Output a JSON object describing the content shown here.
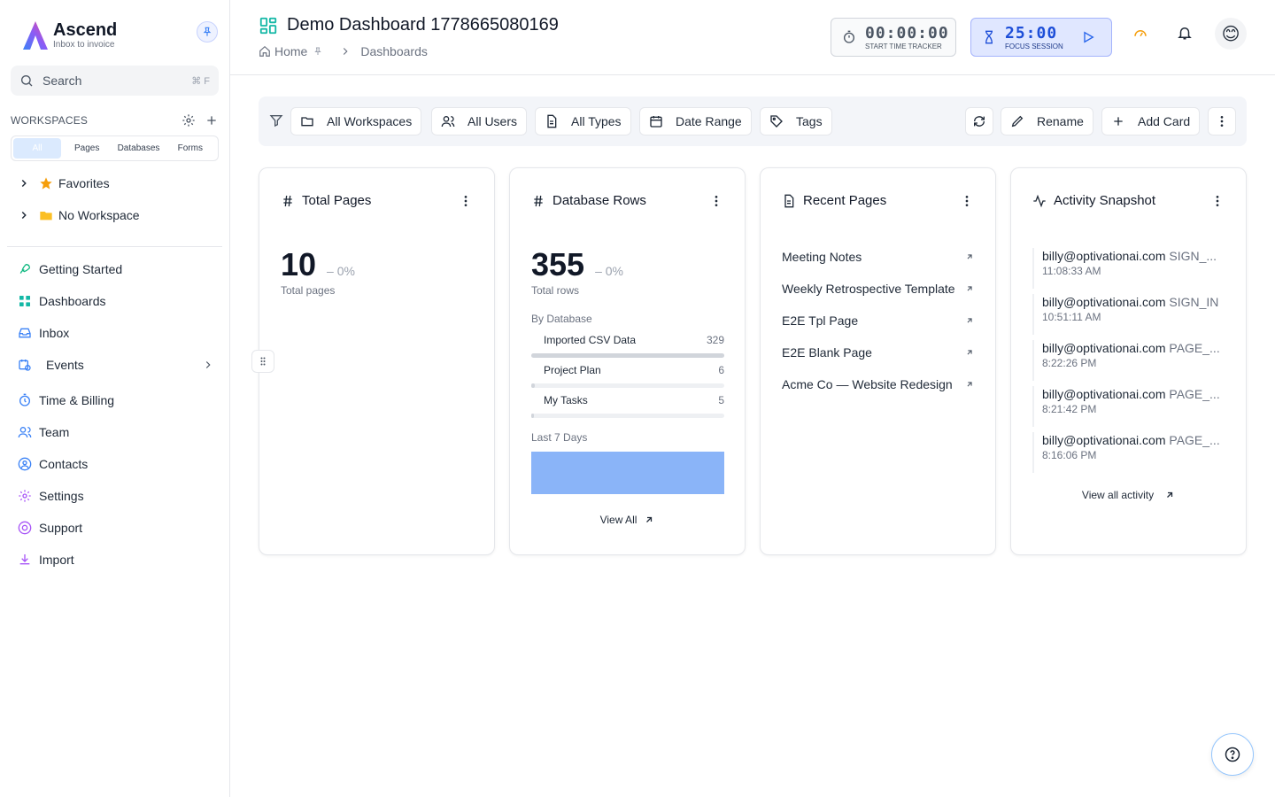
{
  "brand": {
    "name": "Ascend",
    "tagline": "Inbox to invoice"
  },
  "search": {
    "label": "Search",
    "shortcut": "⌘ F"
  },
  "workspaces": {
    "title": "WORKSPACES",
    "tabs": [
      "All",
      "Pages",
      "Databases",
      "Forms"
    ],
    "active_tab": "All",
    "tree": [
      {
        "label": "Favorites",
        "icon": "star-icon"
      },
      {
        "label": "No Workspace",
        "icon": "folder-icon"
      }
    ]
  },
  "nav": [
    {
      "label": "Getting Started",
      "icon": "rocket-icon"
    },
    {
      "label": "Dashboards",
      "icon": "dashboard-icon"
    },
    {
      "label": "Inbox",
      "icon": "inbox-icon"
    },
    {
      "label": "Events",
      "icon": "calendar-clock-icon"
    },
    {
      "label": "Time & Billing",
      "icon": "timer-icon"
    },
    {
      "label": "Team",
      "icon": "users-icon"
    },
    {
      "label": "Contacts",
      "icon": "contact-icon"
    },
    {
      "label": "Settings",
      "icon": "gear-icon"
    },
    {
      "label": "Support",
      "icon": "lifebuoy-icon"
    },
    {
      "label": "Import",
      "icon": "download-icon"
    }
  ],
  "header": {
    "title": "Demo Dashboard 1778665080169",
    "breadcrumb": {
      "home": "Home",
      "current": "Dashboards"
    },
    "tracker": {
      "time": "00:00:00",
      "caption": "START TIME TRACKER"
    },
    "focus": {
      "time": "25:00",
      "caption": "FOCUS SESSION"
    },
    "avatar": "😊"
  },
  "toolbar": {
    "workspaces": "All Workspaces",
    "users": "All Users",
    "types": "All Types",
    "date_range": "Date Range",
    "tags": "Tags",
    "rename": "Rename",
    "add_card": "Add Card"
  },
  "cards": {
    "total_pages": {
      "title": "Total Pages",
      "value": "10",
      "delta": "– 0%",
      "label": "Total pages"
    },
    "database_rows": {
      "title": "Database Rows",
      "value": "355",
      "delta": "– 0%",
      "label": "Total rows",
      "by_database_label": "By Database",
      "rows": [
        {
          "name": "Imported CSV Data",
          "value": 329
        },
        {
          "name": "Project Plan",
          "value": 6
        },
        {
          "name": "My Tasks",
          "value": 5
        }
      ],
      "last7_label": "Last 7 Days",
      "view_all": "View All"
    },
    "recent_pages": {
      "title": "Recent Pages",
      "items": [
        "Meeting Notes",
        "Weekly Retrospective Template",
        "E2E Tpl Page",
        "E2E Blank Page",
        "Acme Co — Website Redesign"
      ]
    },
    "activity": {
      "title": "Activity Snapshot",
      "items": [
        {
          "user": "billy@optivationai.com",
          "event": "SIGN_...",
          "time": "11:08:33 AM"
        },
        {
          "user": "billy@optivationai.com",
          "event": "SIGN_IN",
          "time": "10:51:11 AM"
        },
        {
          "user": "billy@optivationai.com",
          "event": "PAGE_...",
          "time": "8:22:26 PM"
        },
        {
          "user": "billy@optivationai.com",
          "event": "PAGE_...",
          "time": "8:21:42 PM"
        },
        {
          "user": "billy@optivationai.com",
          "event": "PAGE_...",
          "time": "8:16:06 PM"
        }
      ],
      "view_all": "View all activity"
    }
  },
  "colors": {
    "accent": "#2563eb",
    "teal": "#10b981",
    "spark": "#8ab4f8"
  }
}
